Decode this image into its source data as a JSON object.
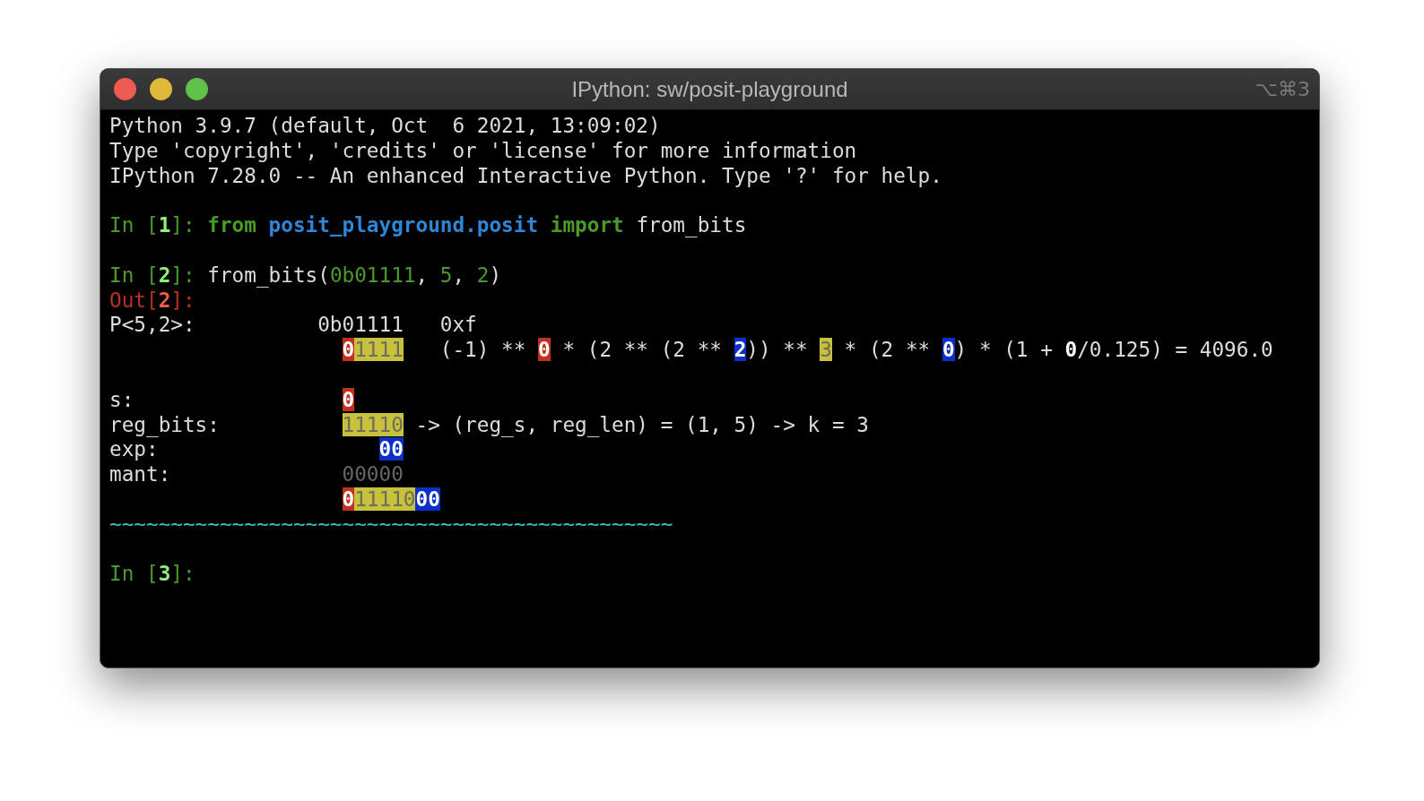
{
  "window": {
    "title": "IPython: sw/posit-playground",
    "shortcut": "⌥⌘3"
  },
  "lines": [
    {
      "kind": "text",
      "segments": [
        {
          "text": "Python 3.9.7 (default, Oct  6 2021, 13:09:02)",
          "kind": "plain"
        }
      ]
    },
    {
      "kind": "text",
      "segments": [
        {
          "text": "Type 'copyright', 'credits' or 'license' for more information",
          "kind": "plain"
        }
      ]
    },
    {
      "kind": "text",
      "segments": [
        {
          "text": "IPython 7.28.0 -- An enhanced Interactive Python. Type '?' for help.",
          "kind": "plain"
        }
      ]
    },
    {
      "kind": "blank"
    },
    {
      "kind": "text",
      "segments": [
        {
          "text": "In [",
          "kind": "prompt"
        },
        {
          "text": "1",
          "kind": "prompt_num"
        },
        {
          "text": "]: ",
          "kind": "prompt"
        },
        {
          "text": "from",
          "kind": "keyword"
        },
        {
          "text": " posit_playground.posit",
          "kind": "module"
        },
        {
          "text": " import",
          "kind": "keyword"
        },
        {
          "text": " from_bits",
          "kind": "plain"
        }
      ]
    },
    {
      "kind": "blank"
    },
    {
      "kind": "text",
      "segments": [
        {
          "text": "In [",
          "kind": "prompt"
        },
        {
          "text": "2",
          "kind": "prompt_num"
        },
        {
          "text": "]: ",
          "kind": "prompt"
        },
        {
          "text": "from_bits(",
          "kind": "plain"
        },
        {
          "text": "0b01111",
          "kind": "number"
        },
        {
          "text": ", ",
          "kind": "plain"
        },
        {
          "text": "5",
          "kind": "number"
        },
        {
          "text": ", ",
          "kind": "plain"
        },
        {
          "text": "2",
          "kind": "number"
        },
        {
          "text": ")",
          "kind": "plain"
        }
      ]
    },
    {
      "kind": "text",
      "segments": [
        {
          "text": "Out[",
          "kind": "out"
        },
        {
          "text": "2",
          "kind": "out_num"
        },
        {
          "text": "]:",
          "kind": "out"
        }
      ]
    },
    {
      "kind": "text",
      "segments": [
        {
          "text": "P<5,2>:          0b01111   0xf",
          "kind": "plain"
        }
      ]
    },
    {
      "kind": "continuation",
      "segments": [
        {
          "text": "0",
          "kind": "sign"
        },
        {
          "text": "1111",
          "kind": "regime"
        },
        {
          "text": "   (-1) ** ",
          "kind": "plain"
        },
        {
          "text": "0",
          "kind": "sign"
        },
        {
          "text": " * (2 ** (2 ** ",
          "kind": "plain"
        },
        {
          "text": "2",
          "kind": "exp"
        },
        {
          "text": ")) ** ",
          "kind": "plain"
        },
        {
          "text": "3",
          "kind": "regime"
        },
        {
          "text": " * (2 ** ",
          "kind": "plain"
        },
        {
          "text": "0",
          "kind": "exp"
        },
        {
          "text": ") * (1 + ",
          "kind": "plain"
        },
        {
          "text": "0",
          "kind": "bold"
        },
        {
          "text": "/0.125) = 4096.0",
          "kind": "plain"
        }
      ]
    },
    {
      "kind": "blank"
    },
    {
      "kind": "field",
      "label": "s:",
      "segments": [
        {
          "text": "0",
          "kind": "sign"
        }
      ]
    },
    {
      "kind": "field",
      "label": "reg_bits:",
      "segments": [
        {
          "text": "11110",
          "kind": "regime"
        },
        {
          "text": " -> (reg_s, reg_len) = (1, 5) -> k = 3",
          "kind": "plain"
        }
      ]
    },
    {
      "kind": "field",
      "label": "exp:                  ",
      "segments": [
        {
          "text": "00",
          "kind": "exp"
        }
      ]
    },
    {
      "kind": "field",
      "label": "mant:",
      "segments": [
        {
          "text": "00000",
          "kind": "dim"
        }
      ]
    },
    {
      "kind": "continuation",
      "segments": [
        {
          "text": "0",
          "kind": "sign"
        },
        {
          "text": "11110",
          "kind": "regime"
        },
        {
          "text": "00",
          "kind": "exp"
        }
      ]
    },
    {
      "kind": "text",
      "segments": [
        {
          "text": "~~~~~~~~~~~~~~~~~~~~~~~~~~~~~~~~~~~~~~~~~~~~~~",
          "kind": "wavy"
        }
      ]
    },
    {
      "kind": "blank"
    },
    {
      "kind": "text",
      "segments": [
        {
          "text": "In [",
          "kind": "prompt"
        },
        {
          "text": "3",
          "kind": "prompt_num"
        },
        {
          "text": "]:",
          "kind": "prompt"
        }
      ]
    }
  ]
}
